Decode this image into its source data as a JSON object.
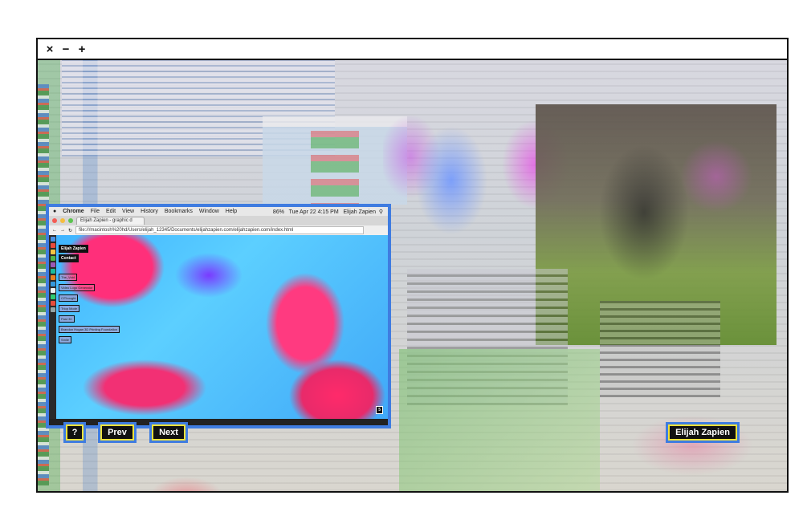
{
  "window_controls": {
    "close": "×",
    "minimize": "−",
    "maximize": "+"
  },
  "screenshot": {
    "menubar": {
      "apple": "",
      "items": [
        "Chrome",
        "File",
        "Edit",
        "View",
        "History",
        "Bookmarks",
        "Window",
        "Help"
      ],
      "battery": "86%",
      "datetime": "Tue Apr 22  4:15 PM",
      "user": "Elijah Zapien"
    },
    "tab_title": "Elijah Zapien - graphic d",
    "url": "file:///macintosh%20hd/Users/elijah_12345/Documents/elijahzapien.com/elijahzapien.com/index.html",
    "page_buttons": [
      "Elijah Zapien",
      "Contact"
    ],
    "page_links": [
      "The_Void",
      "Video Logo Generator",
      "ClThought",
      "Triop Mode",
      "Past 30",
      "Brandon Hogan 3D Printing Foundation",
      "Smile"
    ],
    "corner_box": "5"
  },
  "nav": {
    "help_label": "?",
    "prev_label": "Prev",
    "next_label": "Next",
    "name_label": "Elijah Zapien"
  },
  "colors": {
    "accent_blue": "#3f7ce0",
    "accent_yellow": "#f0e23a",
    "pink": "#ff2f7a",
    "cyan": "#3fb4ff"
  }
}
